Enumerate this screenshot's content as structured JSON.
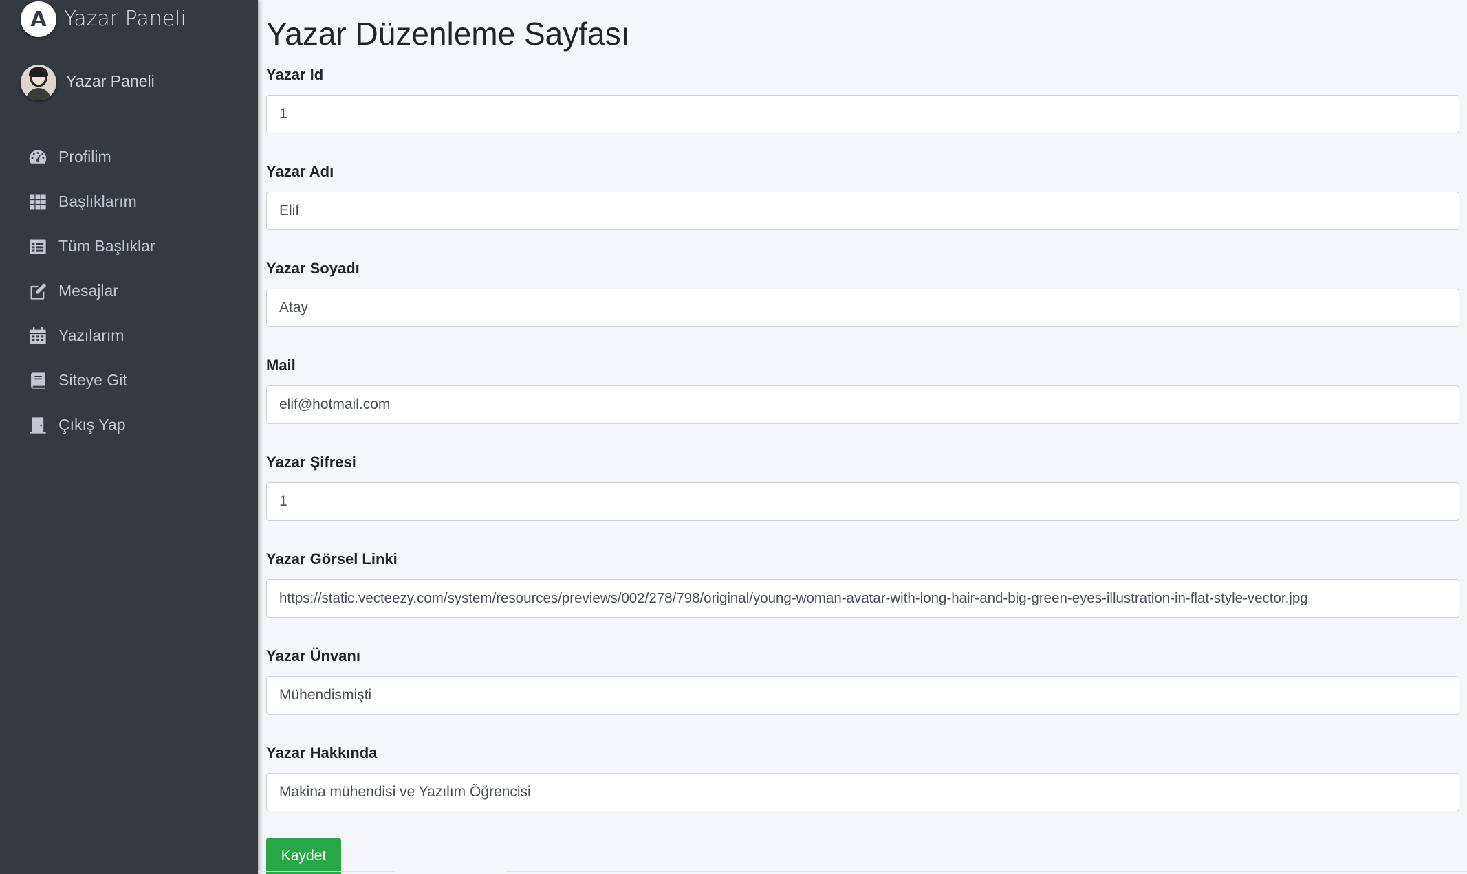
{
  "sidebar": {
    "brand": {
      "logo_letter": "A",
      "title": "Yazar Paneli"
    },
    "user": {
      "name": "Yazar Paneli"
    },
    "items": [
      {
        "label": "Profilim",
        "icon": "tachometer-icon"
      },
      {
        "label": "Başlıklarım",
        "icon": "grid-icon"
      },
      {
        "label": "Tüm Başlıklar",
        "icon": "list-icon"
      },
      {
        "label": "Mesajlar",
        "icon": "edit-icon"
      },
      {
        "label": "Yazılarım",
        "icon": "calendar-icon"
      },
      {
        "label": "Siteye Git",
        "icon": "book-icon"
      },
      {
        "label": "Çıkış Yap",
        "icon": "door-icon"
      }
    ]
  },
  "main": {
    "title": "Yazar Düzenleme Sayfası",
    "fields": [
      {
        "label": "Yazar Id",
        "value": "1"
      },
      {
        "label": "Yazar Adı",
        "value": "Elif"
      },
      {
        "label": "Yazar Soyadı",
        "value": "Atay"
      },
      {
        "label": "Mail",
        "value": "elif@hotmail.com"
      },
      {
        "label": "Yazar Şifresi",
        "value": "1"
      },
      {
        "label": "Yazar Görsel Linki",
        "value": "https://static.vecteezy.com/system/resources/previews/002/278/798/original/young-woman-avatar-with-long-hair-and-big-green-eyes-illustration-in-flat-style-vector.jpg"
      },
      {
        "label": "Yazar Ünvanı",
        "value": "Mühendismişti"
      },
      {
        "label": "Yazar Hakkında",
        "value": "Makina mühendisi ve Yazılım Öğrencisi"
      }
    ],
    "save_label": "Kaydet"
  },
  "colors": {
    "sidebar_bg": "#343a40",
    "content_bg": "#f4f6f9",
    "save_button": "#28a745"
  }
}
